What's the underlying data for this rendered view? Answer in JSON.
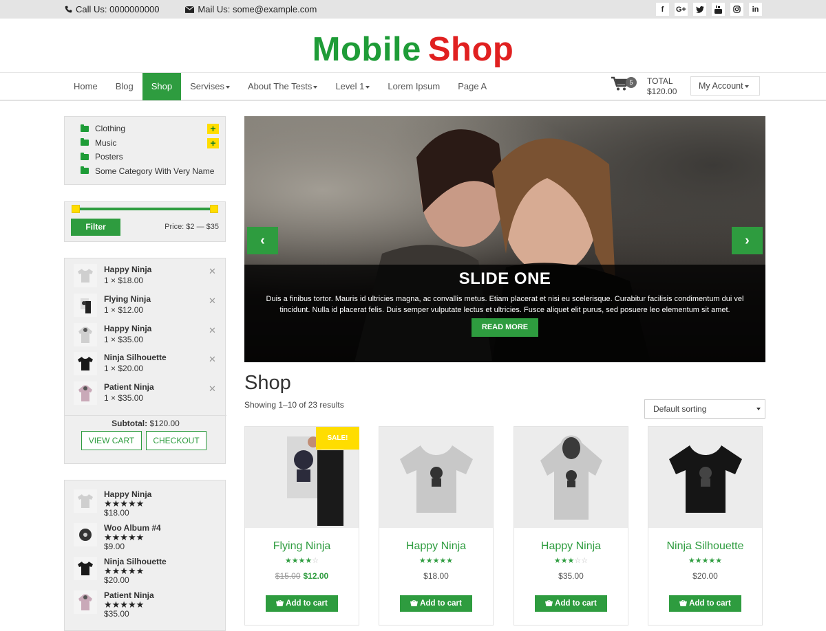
{
  "topbar": {
    "phone": "Call Us: 0000000000",
    "mail": "Mail Us: some@example.com",
    "socials": [
      "facebook-icon",
      "google-plus-icon",
      "twitter-icon",
      "youtube-icon",
      "instagram-icon",
      "linkedin-icon"
    ]
  },
  "logo": {
    "part1": "Mobile",
    "part2": "Shop"
  },
  "nav": {
    "items": [
      {
        "label": "Home"
      },
      {
        "label": "Blog"
      },
      {
        "label": "Shop"
      },
      {
        "label": "Servises"
      },
      {
        "label": "About The Tests"
      },
      {
        "label": "Level 1"
      },
      {
        "label": "Lorem Ipsum"
      },
      {
        "label": "Page A"
      }
    ],
    "active": "Shop",
    "cart_count": "5",
    "total_label": "TOTAL",
    "total_value": "$120.00",
    "account": "My Account"
  },
  "categories": [
    {
      "label": "Clothing",
      "expandable": true
    },
    {
      "label": "Music",
      "expandable": true
    },
    {
      "label": "Posters",
      "expandable": false
    },
    {
      "label": "Some Category With Very Name",
      "expandable": false
    }
  ],
  "price_filter": {
    "button": "Filter",
    "range": "Price: $2 — $35"
  },
  "mini_cart": {
    "items": [
      {
        "name": "Happy Ninja",
        "qty": "1 × $18.00"
      },
      {
        "name": "Flying Ninja",
        "qty": "1 × $12.00"
      },
      {
        "name": "Happy Ninja",
        "qty": "1 × $35.00"
      },
      {
        "name": "Ninja Silhouette",
        "qty": "1 × $20.00"
      },
      {
        "name": "Patient Ninja",
        "qty": "1 × $35.00"
      }
    ],
    "subtotal_label": "Subtotal:",
    "subtotal_value": "$120.00",
    "view_cart": "VIEW CART",
    "checkout": "CHECKOUT"
  },
  "top_rated": [
    {
      "name": "Happy Ninja",
      "stars": "★★★★★",
      "price": "$18.00"
    },
    {
      "name": "Woo Album #4",
      "stars": "★★★★★",
      "price": "$9.00"
    },
    {
      "name": "Ninja Silhouette",
      "stars": "★★★★★",
      "price": "$20.00"
    },
    {
      "name": "Patient Ninja",
      "stars": "★★★★★",
      "price": "$35.00"
    }
  ],
  "slider": {
    "title": "SLIDE ONE",
    "text": "Duis a finibus tortor. Mauris id ultricies magna, ac convallis metus. Etiam placerat et nisi eu scelerisque. Curabitur facilisis condimentum dui vel tincidunt. Nulla id placerat felis. Duis semper vulputate lectus et ultricies. Fusce aliquet elit purus, sed posuere leo elementum sit amet.",
    "button": "READ MORE"
  },
  "shop": {
    "title": "Shop",
    "results": "Showing 1–10 of 23 results",
    "sorting": "Default sorting"
  },
  "products": [
    {
      "name": "Flying Ninja",
      "stars_on": "★★★★",
      "stars_off": "☆",
      "old_price": "$15.00",
      "price": "$12.00",
      "sale": "SALE!",
      "button": "Add to cart"
    },
    {
      "name": "Happy Ninja",
      "stars_on": "★★★★★",
      "stars_off": "",
      "old_price": "",
      "price": "$18.00",
      "sale": "",
      "button": "Add to cart"
    },
    {
      "name": "Happy Ninja",
      "stars_on": "★★★",
      "stars_off": "☆☆",
      "old_price": "",
      "price": "$35.00",
      "sale": "",
      "button": "Add to cart"
    },
    {
      "name": "Ninja Silhouette",
      "stars_on": "★★★★★",
      "stars_off": "",
      "old_price": "",
      "price": "$20.00",
      "sale": "",
      "button": "Add to cart"
    }
  ],
  "colors": {
    "accent": "#2e9c3f",
    "brand_red": "#e02020",
    "sale_yellow": "#ffdd00"
  }
}
